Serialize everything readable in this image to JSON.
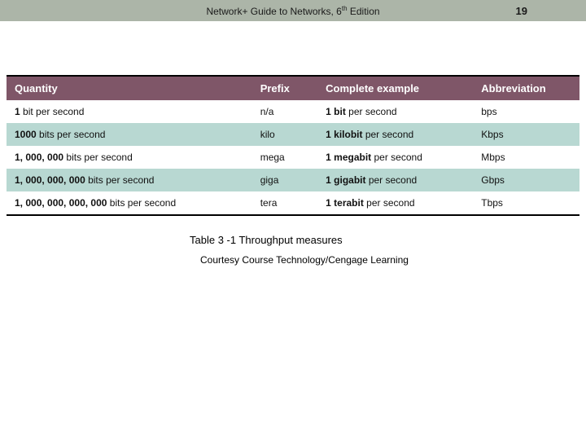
{
  "header": {
    "title_pre": "Network+ Guide to Networks, 6",
    "title_sup": "th",
    "title_post": " Edition",
    "page_number": "19"
  },
  "table": {
    "columns": {
      "quantity": "Quantity",
      "prefix": "Prefix",
      "example": "Complete example",
      "abbrev": "Abbreviation"
    },
    "rows": [
      {
        "qty_bold": "1",
        "qty_rest": " bit per second",
        "prefix": "n/a",
        "ex_bold": "1 bit",
        "ex_rest": " per second",
        "abbrev": "bps"
      },
      {
        "qty_bold": "1000",
        "qty_rest": " bits per second",
        "prefix": "kilo",
        "ex_bold": "1 kilobit",
        "ex_rest": " per second",
        "abbrev": "Kbps"
      },
      {
        "qty_bold": "1, 000, 000",
        "qty_rest": " bits per second",
        "prefix": "mega",
        "ex_bold": "1 megabit",
        "ex_rest": " per second",
        "abbrev": "Mbps"
      },
      {
        "qty_bold": "1, 000, 000, 000",
        "qty_rest": " bits per second",
        "prefix": "giga",
        "ex_bold": "1 gigabit",
        "ex_rest": " per second",
        "abbrev": "Gbps"
      },
      {
        "qty_bold": "1, 000, 000, 000, 000",
        "qty_rest": " bits per second",
        "prefix": "tera",
        "ex_bold": "1 terabit",
        "ex_rest": " per second",
        "abbrev": "Tbps"
      }
    ]
  },
  "caption": "Table 3 -1 Throughput measures",
  "courtesy": "Courtesy Course Technology/Cengage Learning"
}
